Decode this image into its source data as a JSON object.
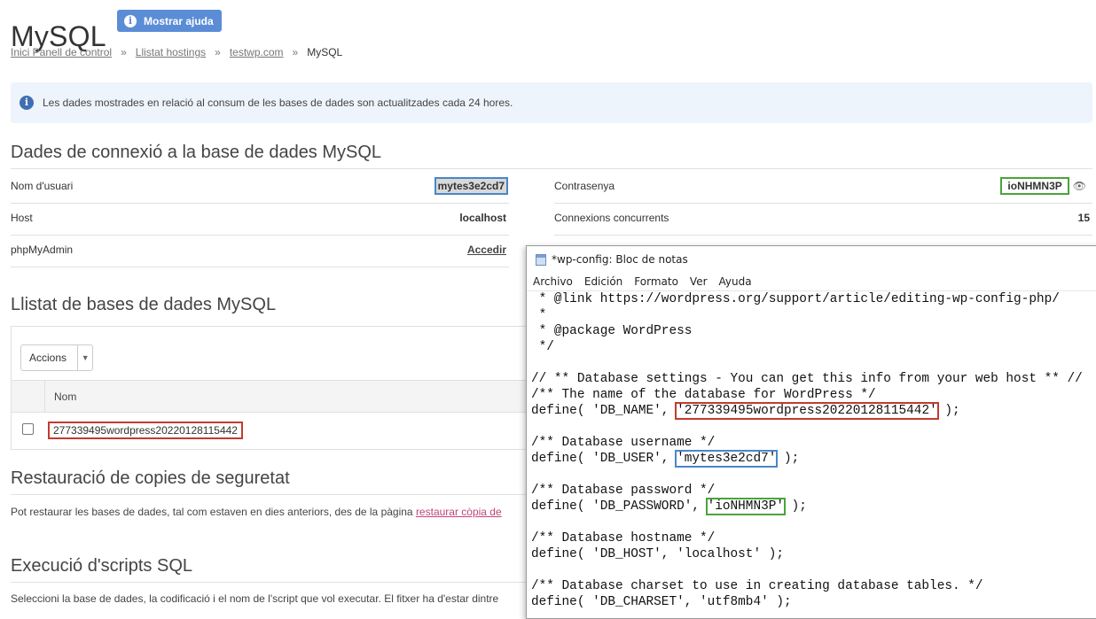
{
  "page": {
    "title": "MySQL",
    "help_label": "Mostrar ajuda",
    "breadcrumb": [
      "Inici Panell de control",
      "Llistat hostings",
      "testwp.com",
      "MySQL"
    ],
    "breadcrumb_sep": "»",
    "notice": "Les dades mostrades en relació al consum de les bases de dades son actualitzades cada 24 hores."
  },
  "connection": {
    "heading": "Dades de connexió a la base de dades MySQL",
    "user_label": "Nom d'usuari",
    "user_value": "mytes3e2cd7",
    "host_label": "Host",
    "host_value": "localhost",
    "phpmyadmin_label": "phpMyAdmin",
    "phpmyadmin_link": "Accedir",
    "password_label": "Contrasenya",
    "password_value": "ioNHMN3P",
    "connections_label": "Connexions concurrents",
    "connections_value": "15"
  },
  "db_list": {
    "heading": "Llistat de bases de dades MySQL",
    "actions_label": "Accions",
    "col_name": "Nom",
    "rows": [
      "277339495wordpress20220128115442"
    ]
  },
  "restore": {
    "heading": "Restauració de copies de seguretat",
    "text": "Pot restaurar les bases de dades, tal com estaven en dies anteriors, des de la pàgina ",
    "link": "restaurar còpia de"
  },
  "scripts": {
    "heading": "Execució d'scripts SQL",
    "text": "Seleccioni la base de dades, la codificació i el nom de l'script que vol executar. El fitxer ha d'estar dintre"
  },
  "notepad": {
    "title": "*wp-config: Bloc de notas",
    "menu": [
      "Archivo",
      "Edición",
      "Formato",
      "Ver",
      "Ayuda"
    ],
    "lines": {
      "l1": " * @link https://wordpress.org/support/article/editing-wp-config-php/",
      "l2": " *",
      "l3": " * @package WordPress",
      "l4": " */",
      "l5": "",
      "l6": "// ** Database settings - You can get this info from your web host ** //",
      "l7": "/** The name of the database for WordPress */",
      "l8a": "define( 'DB_NAME', ",
      "l8b": "'277339495wordpress20220128115442'",
      "l8c": " );",
      "l9": "",
      "l10": "/** Database username */",
      "l11a": "define( 'DB_USER', ",
      "l11b": "'mytes3e2cd7'",
      "l11c": " );",
      "l12": "",
      "l13": "/** Database password */",
      "l14a": "define( 'DB_PASSWORD', ",
      "l14b": "'ioNHMN3P'",
      "l14c": " );",
      "l15": "",
      "l16": "/** Database hostname */",
      "l17": "define( 'DB_HOST', 'localhost' );",
      "l18": "",
      "l19": "/** Database charset to use in creating database tables. */",
      "l20": "define( 'DB_CHARSET', 'utf8mb4' );"
    }
  },
  "colors": {
    "accent": "#5b8dd6",
    "highlight_red": "#c23b2e",
    "highlight_blue": "#4a86c8",
    "highlight_green": "#4aa43a"
  }
}
